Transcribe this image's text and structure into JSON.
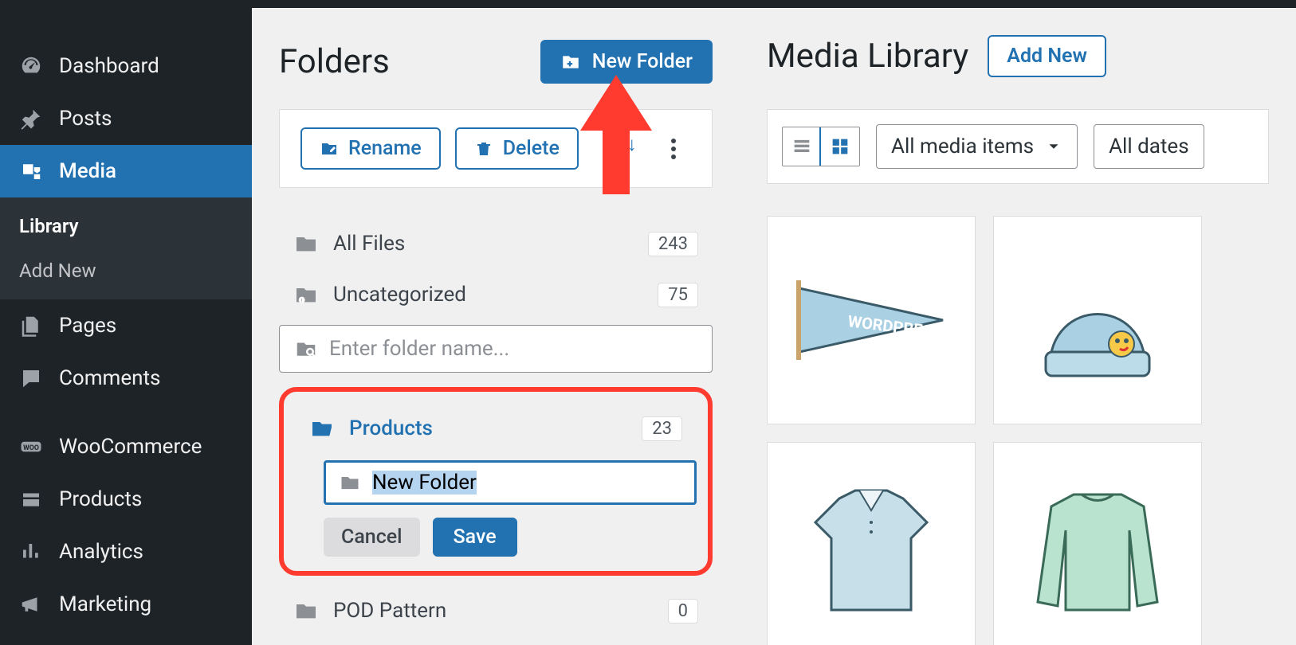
{
  "sidebar": {
    "items": [
      {
        "label": "Dashboard"
      },
      {
        "label": "Posts"
      },
      {
        "label": "Media",
        "active": true,
        "sub": [
          {
            "label": "Library",
            "active": true
          },
          {
            "label": "Add New"
          }
        ]
      },
      {
        "label": "Pages"
      },
      {
        "label": "Comments"
      },
      {
        "label": "WooCommerce"
      },
      {
        "label": "Products"
      },
      {
        "label": "Analytics"
      },
      {
        "label": "Marketing"
      }
    ]
  },
  "folders": {
    "title": "Folders",
    "new_btn": "New Folder",
    "rename_btn": "Rename",
    "delete_btn": "Delete",
    "search_placeholder": "Enter folder name...",
    "cancel_btn": "Cancel",
    "save_btn": "Save",
    "new_name_value": "New Folder",
    "list": [
      {
        "label": "All Files",
        "count": "243"
      },
      {
        "label": "Uncategorized",
        "count": "75"
      },
      {
        "label": "Products",
        "count": "23",
        "selected": true
      },
      {
        "label": "POD Pattern",
        "count": "0"
      }
    ]
  },
  "library": {
    "title": "Media Library",
    "add_new": "Add New",
    "filter1": "All media items",
    "filter2": "All dates"
  }
}
